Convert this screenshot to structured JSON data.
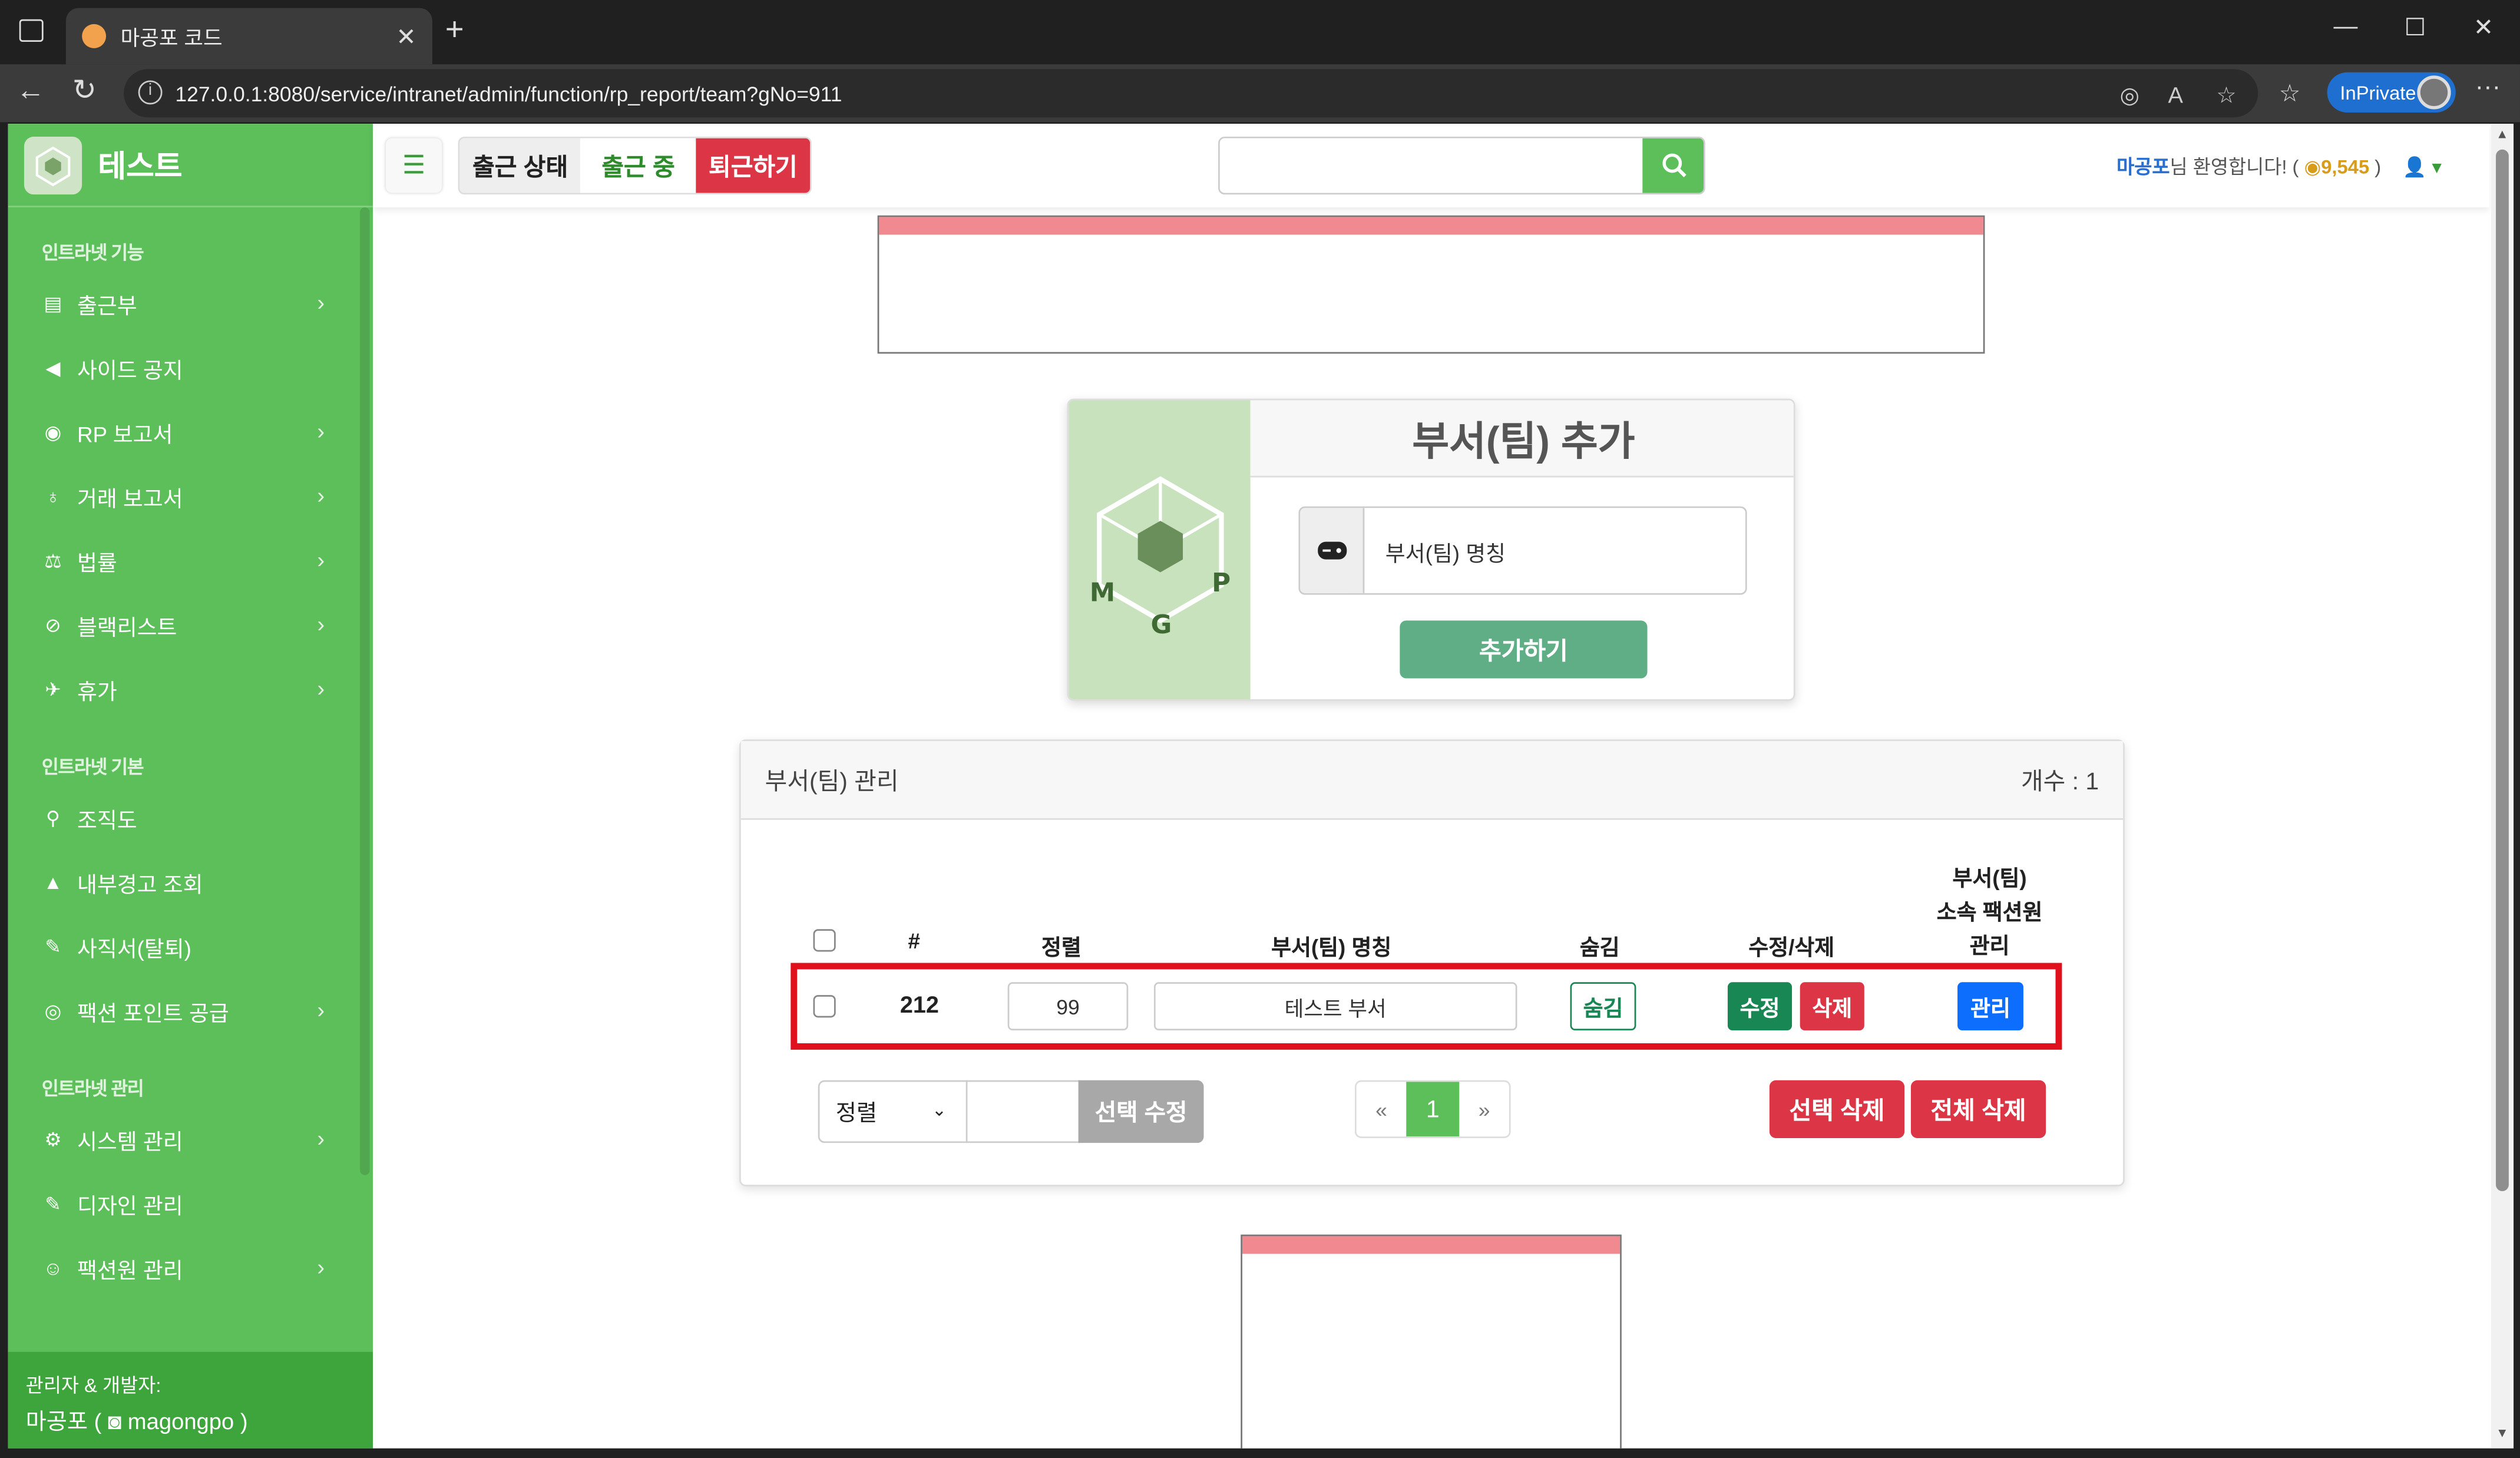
{
  "browser": {
    "tab_title": "마공포 코드",
    "url": "127.0.0.1:8080/service/intranet/admin/function/rp_report/team?gNo=911",
    "inprivate_label": "InPrivate"
  },
  "sidebar": {
    "brand": "테스트",
    "sections": [
      {
        "title": "인트라넷 기능",
        "items": [
          {
            "label": "출근부",
            "icon": "book-icon",
            "has_submenu": true
          },
          {
            "label": "사이드 공지",
            "icon": "megaphone-icon",
            "has_submenu": false
          },
          {
            "label": "RP 보고서",
            "icon": "gamepad-icon",
            "has_submenu": true
          },
          {
            "label": "거래 보고서",
            "icon": "money-bag-icon",
            "has_submenu": true
          },
          {
            "label": "법률",
            "icon": "scale-icon",
            "has_submenu": true
          },
          {
            "label": "블랙리스트",
            "icon": "ban-icon",
            "has_submenu": true
          },
          {
            "label": "휴가",
            "icon": "plane-icon",
            "has_submenu": true
          }
        ]
      },
      {
        "title": "인트라넷 기본",
        "items": [
          {
            "label": "조직도",
            "icon": "sitemap-icon",
            "has_submenu": false
          },
          {
            "label": "내부경고 조회",
            "icon": "warning-icon",
            "has_submenu": false
          },
          {
            "label": "사직서(탈퇴)",
            "icon": "feather-icon",
            "has_submenu": false
          },
          {
            "label": "팩션 포인트 공급",
            "icon": "coins-icon",
            "has_submenu": true
          }
        ]
      },
      {
        "title": "인트라넷 관리",
        "items": [
          {
            "label": "시스템 관리",
            "icon": "gear-icon",
            "has_submenu": true
          },
          {
            "label": "디자인 관리",
            "icon": "feather-icon",
            "has_submenu": false
          },
          {
            "label": "팩션원 관리",
            "icon": "user-gear-icon",
            "has_submenu": true
          }
        ]
      }
    ],
    "footer_line1": "관리자 & 개발자:",
    "footer_name": "마공포 (",
    "footer_handle": "magongpo )"
  },
  "topbar": {
    "attendance_status": "출근 상태",
    "attendance_current": "출근 중",
    "leave_button": "퇴근하기",
    "search_placeholder": "",
    "user_name": "마공포",
    "user_greeting": "님 환영합니다! (",
    "user_points": "9,545",
    "user_close": ")"
  },
  "add_card": {
    "title": "부서(팀) 추가",
    "field_label": "부서(팀) 명칭",
    "add_button": "추가하기",
    "logo_letters": "MGP"
  },
  "manage_card": {
    "title": "부서(팀) 관리",
    "count": "개수 : 1",
    "columns": [
      "#",
      "정렬",
      "부서(팀) 명칭",
      "숨김",
      "수정/삭제"
    ],
    "members_column": [
      "부서(팀)",
      "소속 팩션원",
      "관리"
    ],
    "rows": [
      {
        "id": "212",
        "sort": "99",
        "name": "테스트 부서",
        "hide": "숨김",
        "edit": "수정",
        "delete": "삭제",
        "manage": "관리"
      }
    ],
    "footer": {
      "select_value": "정렬",
      "edit_selected": "선택 수정",
      "pager_prev": "«",
      "pager_current": "1",
      "pager_next": "»",
      "delete_selected": "선택 삭제",
      "delete_all": "전체 삭제"
    }
  },
  "colors": {
    "brand_green": "#5cbf5a",
    "danger": "#dc3545",
    "primary": "#0d6efd",
    "success_dark": "#198754",
    "highlight": "#e0101c"
  }
}
